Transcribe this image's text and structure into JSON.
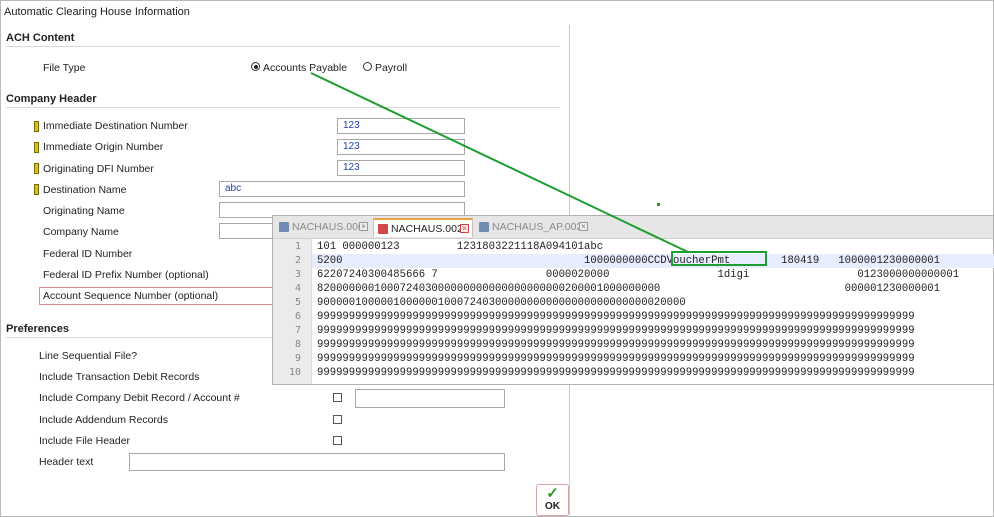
{
  "window": {
    "title": "Automatic Clearing House Information"
  },
  "ach_content": {
    "heading": "ACH Content",
    "file_type_label": "File Type",
    "options": [
      "Accounts Payable",
      "Payroll"
    ],
    "selected": "Accounts Payable"
  },
  "company_header": {
    "heading": "Company Header",
    "fields": [
      {
        "label": "Immediate Destination Number",
        "value": "123",
        "required": true
      },
      {
        "label": "Immediate Origin Number",
        "value": "123",
        "required": true
      },
      {
        "label": "Originating DFI Number",
        "value": "123",
        "required": true
      },
      {
        "label": "Destination Name",
        "value": "abc",
        "required": true
      },
      {
        "label": "Originating Name",
        "value": "",
        "required": false
      },
      {
        "label": "Company Name",
        "value": "",
        "required": false
      },
      {
        "label": "Federal ID Number",
        "value": "",
        "required": false
      },
      {
        "label": "Federal ID Prefix Number (optional)",
        "value": "",
        "required": false
      },
      {
        "label": "Account Sequence Number (optional)",
        "value": "",
        "required": false,
        "error": true
      }
    ]
  },
  "preferences": {
    "heading": "Preferences",
    "items": [
      {
        "label": "Line Sequential File?"
      },
      {
        "label": "Include Transaction Debit Records"
      },
      {
        "label": "Include Company Debit Record / Account #",
        "checked": false,
        "value": ""
      },
      {
        "label": "Include Addendum Records",
        "checked": false
      },
      {
        "label": "Include File Header",
        "checked": false
      },
      {
        "label": "Header text",
        "value": ""
      }
    ]
  },
  "ok_button": {
    "label": "OK"
  },
  "editor": {
    "tabs": [
      {
        "label": "NACHAUS.000",
        "active": false
      },
      {
        "label": "NACHAUS.002",
        "active": true
      },
      {
        "label": "NACHAUS_AP.002",
        "active": false
      }
    ],
    "line_numbers": [
      "1",
      "2",
      "3",
      "4",
      "5",
      "6",
      "7",
      "8",
      "9",
      "10"
    ],
    "lines": [
      "101 000000123         1231803221118A094101abc",
      "5200                                      1000000000CCDVoucherPmt        180419   1000001230000001",
      "62207240300485666 7                 0000020000                 1digi                 0123000000000001",
      "820000000100072403000000000000000000000200001000000000                             000001230000001",
      "9000001000001000000100072403000000000000000000000000020000",
      "9999999999999999999999999999999999999999999999999999999999999999999999999999999999999999999999",
      "9999999999999999999999999999999999999999999999999999999999999999999999999999999999999999999999",
      "9999999999999999999999999999999999999999999999999999999999999999999999999999999999999999999999",
      "9999999999999999999999999999999999999999999999999999999999999999999999999999999999999999999999",
      "9999999999999999999999999999999999999999999999999999999999999999999999999999999999999999999999"
    ]
  },
  "colors": {
    "callout": "#1e9e32",
    "required_marker": "#d7be2c",
    "error_border": "#e08a8a",
    "active_tab_accent": "#e8a048",
    "line_highlight": "#e8ecff"
  }
}
